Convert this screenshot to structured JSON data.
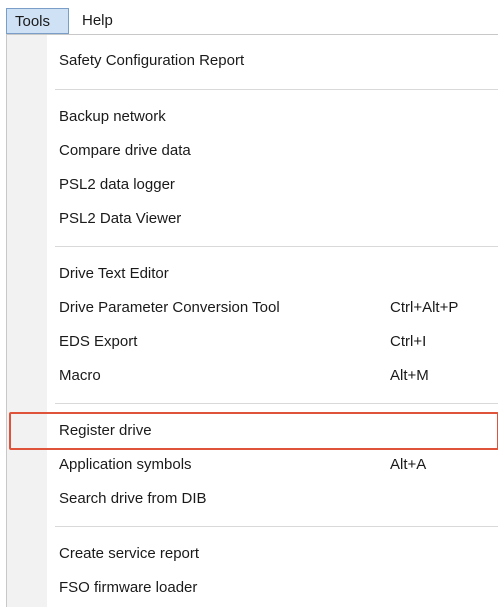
{
  "menubar": {
    "tools_label": "Tools",
    "help_label": "Help"
  },
  "menu": {
    "groups": [
      [
        {
          "label": "Safety Configuration Report",
          "shortcut": ""
        }
      ],
      [
        {
          "label": "Backup network",
          "shortcut": ""
        },
        {
          "label": "Compare drive data",
          "shortcut": ""
        },
        {
          "label": "PSL2 data logger",
          "shortcut": ""
        },
        {
          "label": "PSL2 Data Viewer",
          "shortcut": ""
        }
      ],
      [
        {
          "label": "Drive Text Editor",
          "shortcut": ""
        },
        {
          "label": "Drive Parameter Conversion Tool",
          "shortcut": "Ctrl+Alt+P"
        },
        {
          "label": "EDS Export",
          "shortcut": "Ctrl+I"
        },
        {
          "label": "Macro",
          "shortcut": "Alt+M"
        }
      ],
      [
        {
          "label": "Register drive",
          "shortcut": "",
          "highlighted": true
        },
        {
          "label": "Application symbols",
          "shortcut": "Alt+A"
        },
        {
          "label": "Search drive from DIB",
          "shortcut": ""
        }
      ],
      [
        {
          "label": "Create service report",
          "shortcut": ""
        },
        {
          "label": "FSO firmware loader",
          "shortcut": ""
        }
      ]
    ]
  },
  "colors": {
    "highlight_border": "#e0533b",
    "active_menu_bg": "#cfe1f5"
  }
}
